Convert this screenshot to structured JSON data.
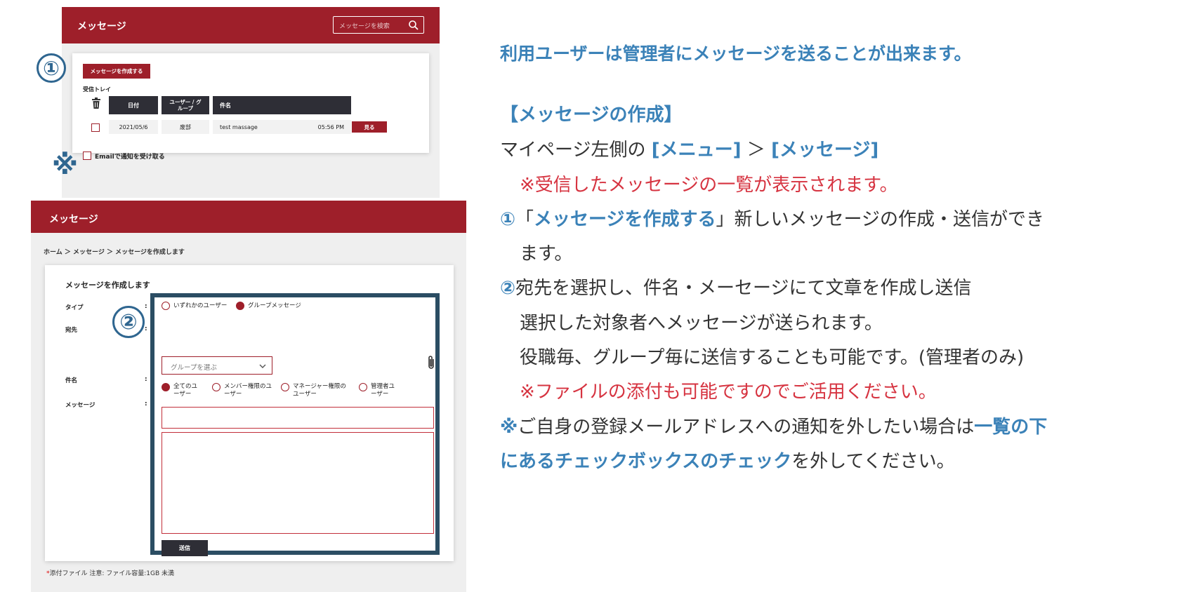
{
  "screen1": {
    "header_title": "メッセージ",
    "search_placeholder": "メッセージを検索",
    "compose_button": "メッセージを作成する",
    "inbox_label": "受信トレイ",
    "columns": [
      "日付",
      "ユーザー / グループ",
      "件名"
    ],
    "row": {
      "date": "2021/05/6",
      "user": "废部",
      "subject": "test massage",
      "time": "05:56 PM",
      "view_button": "見る"
    },
    "notify_label": "Emailで通知を受け取る"
  },
  "markers": {
    "one": "①",
    "two": "②",
    "note": "※"
  },
  "screen2": {
    "header_title": "メッセージ",
    "breadcrumb": "ホーム ＞ メッセージ ＞ メッセージを作成します",
    "card_title": "メッセージを作成します",
    "labels": {
      "type": "タイプ",
      "recipient": "宛先",
      "subject": "件名",
      "message": "メッセージ"
    },
    "colon": ":",
    "type_options": [
      {
        "label": "いずれかのユーザー",
        "selected": false
      },
      {
        "label": "グループメッセージ",
        "selected": true
      }
    ],
    "group_select": "グループを選ぶ",
    "audience_options": [
      {
        "line1": "全てのユ",
        "line2": "ーザー",
        "selected": true
      },
      {
        "line1": "メンバー権限のユ",
        "line2": "ーザー",
        "selected": false
      },
      {
        "line1": "マネージャー権限の",
        "line2": "ユーザー",
        "selected": false
      },
      {
        "line1": "管理者ユ",
        "line2": "ーザー",
        "selected": false
      }
    ],
    "send_button": "送信",
    "footer_required": "*",
    "footer_note": "添付ファイル 注意: ファイル容量:1GB 未満"
  },
  "explain": {
    "headline": "利用ユーザーは管理者にメッセージを送ることが出来ます。",
    "section_title": "【メッセージの作成】",
    "nav_prefix": "マイページ左側の ",
    "nav_menu": "[メニュー]",
    "nav_sep": " ＞ ",
    "nav_message": "[メッセージ]",
    "note_inbox": "※受信したメッセージの一覧が表示されます。",
    "step1_num": "①",
    "step1_open": "「",
    "step1_bold": "メッセージを作成する",
    "step1_rest": "」新しいメッセージの作成・送信ができ",
    "step1_cont": "ます。",
    "step2_num": "②",
    "step2_text": "宛先を選択し、件名・メーセージにて文章を作成し送信",
    "step2_line2": "選択した対象者へメッセージが送られます。",
    "step2_line3": "役職毎、グループ毎に送信することも可能です。(管理者のみ)",
    "note_attach": "※ファイルの添付も可能ですのでご活用ください。",
    "note_mark": "※",
    "note_text1": "ご自身の登録メールアドレスへの通知を外したい場合は",
    "note_bold1": "一覧の下",
    "note_bold2": "にあるチェックボックスのチェック",
    "note_text2": "を外してください。"
  },
  "colors": {
    "brand_red": "#9e1f2a",
    "dark": "#2e2e36",
    "highlight_border": "#2b4d63",
    "accent_blue": "#3b82b8",
    "note_red": "#d63340"
  }
}
